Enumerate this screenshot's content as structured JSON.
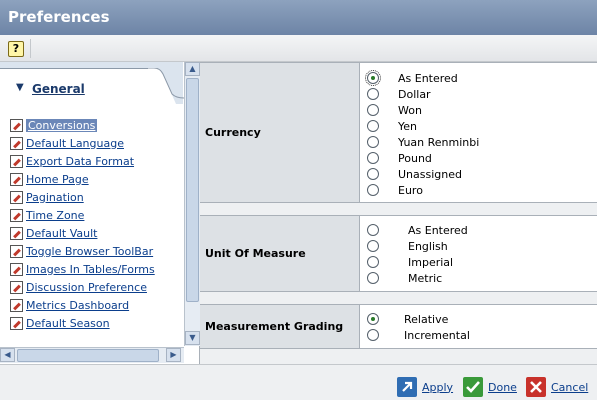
{
  "window": {
    "title": "Preferences"
  },
  "toolbar": {
    "help_label": "?"
  },
  "sidebar": {
    "tab_label": "General",
    "items": [
      {
        "label": "Conversions",
        "active": true
      },
      {
        "label": "Default Language"
      },
      {
        "label": "Export Data Format"
      },
      {
        "label": "Home Page"
      },
      {
        "label": "Pagination"
      },
      {
        "label": "Time Zone"
      },
      {
        "label": "Default Vault"
      },
      {
        "label": "Toggle Browser ToolBar"
      },
      {
        "label": "Images In Tables/Forms"
      },
      {
        "label": "Discussion Preference"
      },
      {
        "label": "Metrics Dashboard"
      },
      {
        "label": "Default Season"
      }
    ]
  },
  "settings": {
    "currency": {
      "label": "Currency",
      "selected": "As Entered",
      "options": [
        "As Entered",
        "Dollar",
        "Won",
        "Yen",
        "Yuan Renminbi",
        "Pound",
        "Unassigned",
        "Euro"
      ]
    },
    "unit_of_measure": {
      "label": "Unit Of Measure",
      "selected": "",
      "options": [
        "As Entered",
        "English",
        "Imperial",
        "Metric"
      ]
    },
    "measurement_grading": {
      "label": "Measurement Grading",
      "selected": "Relative",
      "options": [
        "Relative",
        "Incremental"
      ]
    }
  },
  "footer": {
    "apply_label": "Apply",
    "done_label": "Done",
    "cancel_label": "Cancel"
  },
  "colors": {
    "title_bar": "#7f95b5",
    "apply": "#2f6db3",
    "done": "#3a9a3a",
    "cancel": "#c8322b"
  }
}
